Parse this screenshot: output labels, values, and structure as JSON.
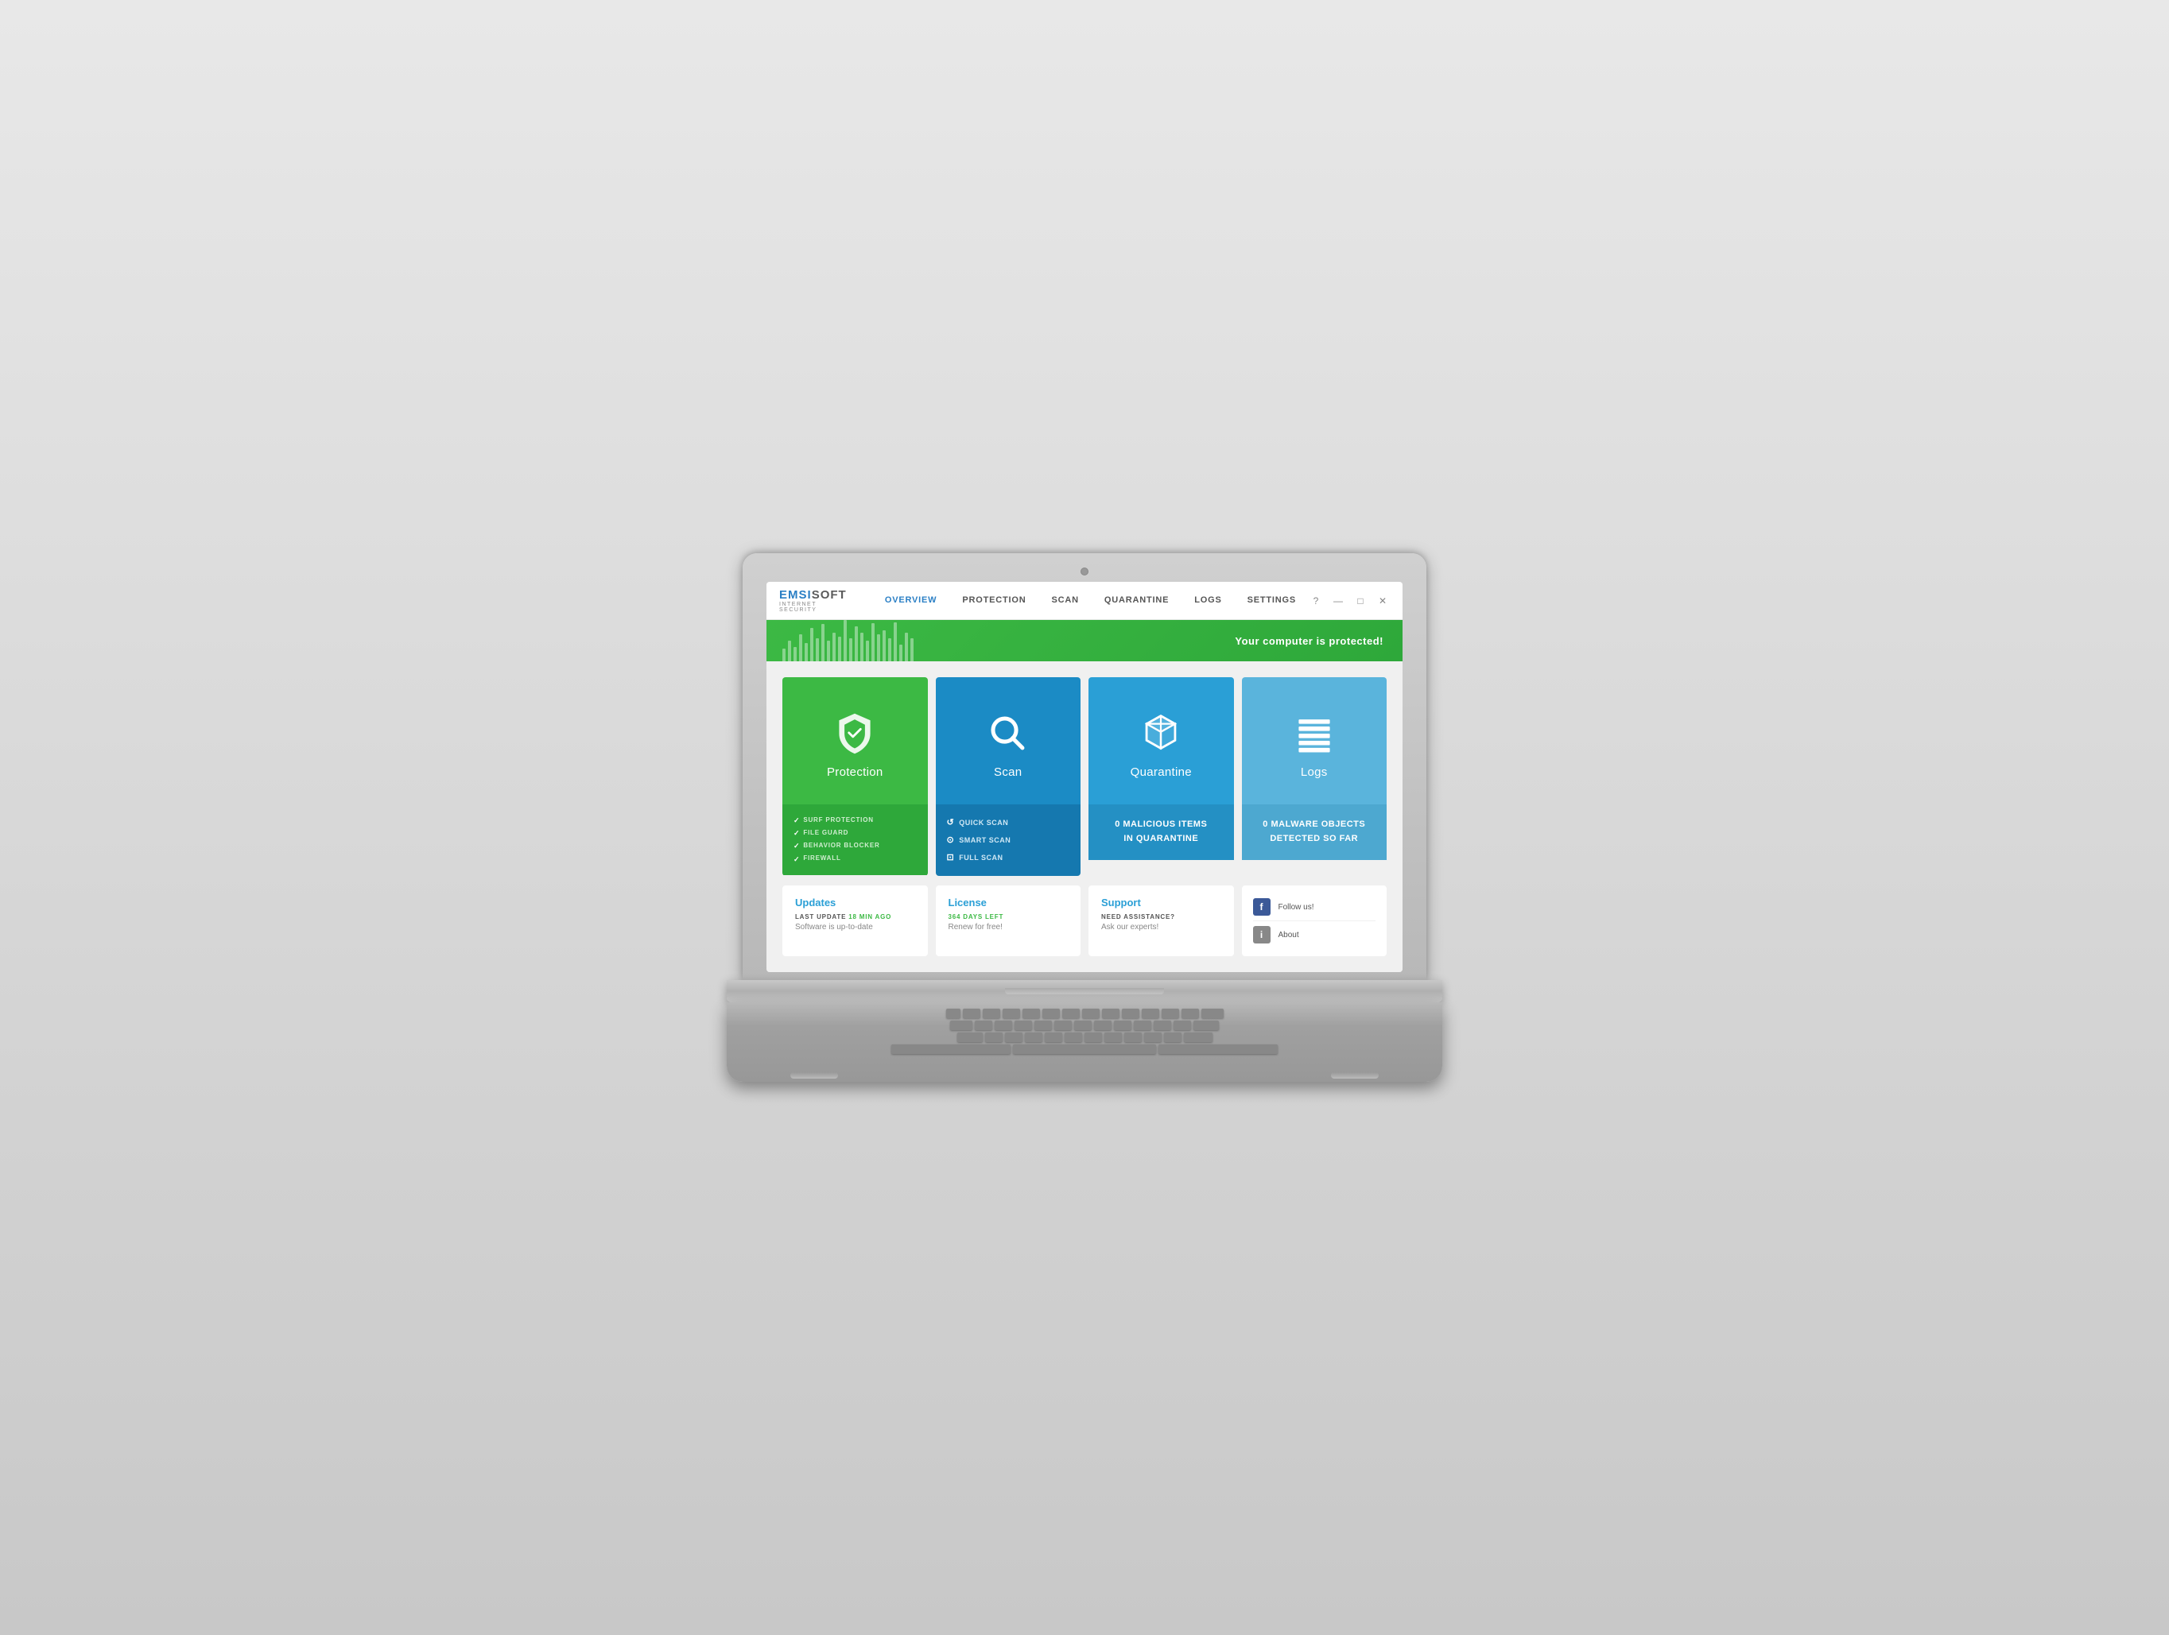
{
  "laptop": {
    "camera_label": "camera"
  },
  "app": {
    "logo": {
      "em": "EMSI",
      "si": "SOFT",
      "subtitle": "INTERNET SECURITY"
    },
    "nav": [
      {
        "id": "overview",
        "label": "OVERVIEW",
        "active": true
      },
      {
        "id": "protection",
        "label": "PROTECTION"
      },
      {
        "id": "scan",
        "label": "SCAN"
      },
      {
        "id": "quarantine",
        "label": "QUARANTINE"
      },
      {
        "id": "logs",
        "label": "LOGS"
      },
      {
        "id": "settings",
        "label": "SETTINGS"
      }
    ],
    "controls": {
      "help": "?",
      "minimize": "—",
      "maximize": "□",
      "close": "✕"
    },
    "status_banner": {
      "text": "Your computer is protected!",
      "bars": [
        8,
        14,
        10,
        18,
        12,
        22,
        16,
        28,
        14,
        20,
        18,
        30,
        16,
        24,
        20,
        14,
        26,
        18,
        22,
        16,
        28,
        12,
        20,
        16
      ]
    },
    "cards": {
      "protection": {
        "title": "Protection",
        "items": [
          "SURF PROTECTION",
          "FILE GUARD",
          "BEHAVIOR BLOCKER",
          "FIREWALL"
        ]
      },
      "scan": {
        "title": "Scan",
        "items": [
          "QUICK SCAN",
          "SMART SCAN",
          "FULL SCAN"
        ]
      },
      "quarantine": {
        "title": "Quarantine",
        "line1": "0 MALICIOUS ITEMS",
        "line2": "IN QUARANTINE"
      },
      "logs": {
        "title": "Logs",
        "line1": "0 MALWARE OBJECTS",
        "line2": "DETECTED SO FAR"
      }
    },
    "bottom_cards": {
      "updates": {
        "title": "Updates",
        "meta_label": "LAST UPDATE",
        "meta_value": "18 MIN AGO",
        "sub": "Software is up-to-date"
      },
      "license": {
        "title": "License",
        "meta_label": "364 DAYS LEFT",
        "sub": "Renew for free!"
      },
      "support": {
        "title": "Support",
        "meta_label": "NEED ASSISTANCE?",
        "sub": "Ask our experts!"
      },
      "social": {
        "follow_label": "Follow us!",
        "about_label": "About"
      }
    }
  }
}
